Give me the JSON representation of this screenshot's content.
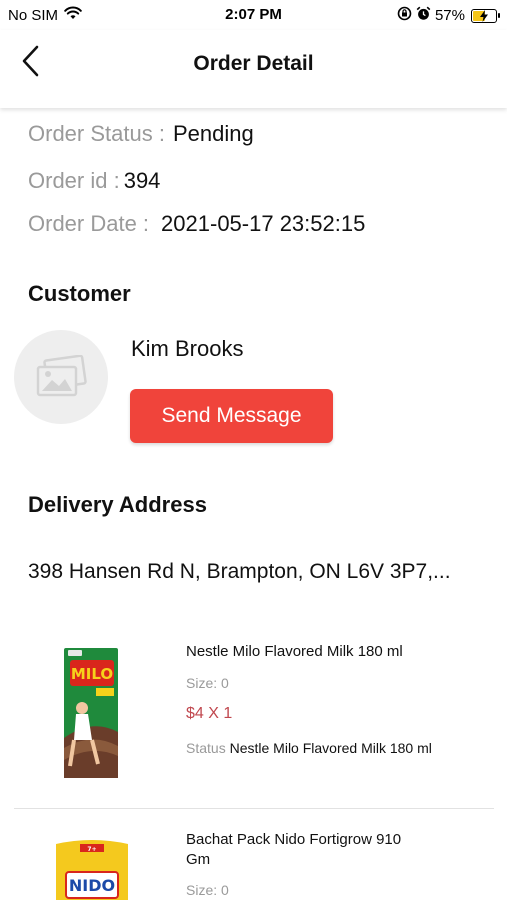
{
  "status_bar": {
    "carrier": "No SIM",
    "time": "2:07 PM",
    "battery_percent": "57%",
    "battery_level": 0.57,
    "icons": [
      "wifi-icon",
      "lock-rotation-icon",
      "alarm-icon",
      "battery-charging-icon"
    ]
  },
  "header": {
    "title": "Order Detail",
    "back_icon": "chevron-left-icon"
  },
  "order": {
    "status_label": "Order Status :",
    "status_value": "Pending",
    "id_label": "Order id :",
    "id_value": "394",
    "date_label": "Order Date :",
    "date_value": "2021-05-17 23:52:15"
  },
  "customer": {
    "section_title": "Customer",
    "name": "Kim Brooks",
    "avatar_icon": "image-placeholder-icon",
    "send_message_label": "Send Message"
  },
  "delivery": {
    "section_title": "Delivery Address",
    "address": "398 Hansen Rd N, Brampton, ON L6V 3P7,..."
  },
  "products": [
    {
      "name": "Nestle Milo Flavored Milk 180 ml",
      "size_label": "Size:",
      "size_value": "0",
      "price": "$4 X 1",
      "status_label": "Status",
      "status_value": "Nestle Milo Flavored Milk 180 ml",
      "thumb_brand": "MILO"
    },
    {
      "name": "Bachat Pack Nido Fortigrow 910 Gm",
      "size_label": "Size:",
      "size_value": "0",
      "thumb_brand": "NIDO"
    }
  ],
  "colors": {
    "accent": "#f0443b",
    "price": "#c0474e",
    "muted": "#9a9a9a"
  }
}
